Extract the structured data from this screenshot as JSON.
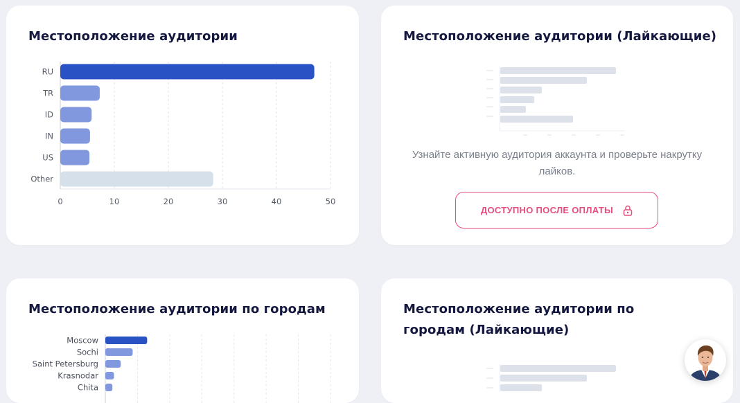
{
  "cards": {
    "country": {
      "title": "Местоположение аудитории"
    },
    "country_likers": {
      "title": "Местоположение аудитории (Лайкающие)",
      "description": "Узнайте активную аудитория аккаунта и проверьте накрутку лайков.",
      "button_label": "ДОСТУПНО ПОСЛЕ ОПЛАТЫ",
      "button_icon": "lock-icon"
    },
    "city": {
      "title": "Местоположение аудитории по городам"
    },
    "city_likers": {
      "title": "Местоположение аудитории по городам (Лайкающие)"
    }
  },
  "colors": {
    "primary_bar": "#2952c4",
    "secondary_bar": "#8198df",
    "other_bar": "#d6e0ea",
    "accent": "#e74c7c",
    "title": "#14183e"
  },
  "support_avatar": {
    "icon": "support-avatar-icon"
  },
  "chart_data": [
    {
      "type": "bar",
      "orientation": "horizontal",
      "categories": [
        "RU",
        "TR",
        "ID",
        "IN",
        "US",
        "Other"
      ],
      "values": [
        47,
        7.3,
        5.8,
        5.5,
        5.4,
        28.3
      ],
      "xlim": [
        0,
        50
      ],
      "xticks": [
        0,
        10,
        20,
        30,
        40,
        50
      ],
      "grid": true
    },
    {
      "type": "bar",
      "orientation": "horizontal",
      "categories": [
        "Moscow",
        "Sochi",
        "Saint Petersburg",
        "Krasnodar",
        "Chita"
      ],
      "values": [
        13,
        8.5,
        4.8,
        2.7,
        2.2
      ],
      "xlim": [
        0,
        70
      ],
      "grid": true
    }
  ]
}
